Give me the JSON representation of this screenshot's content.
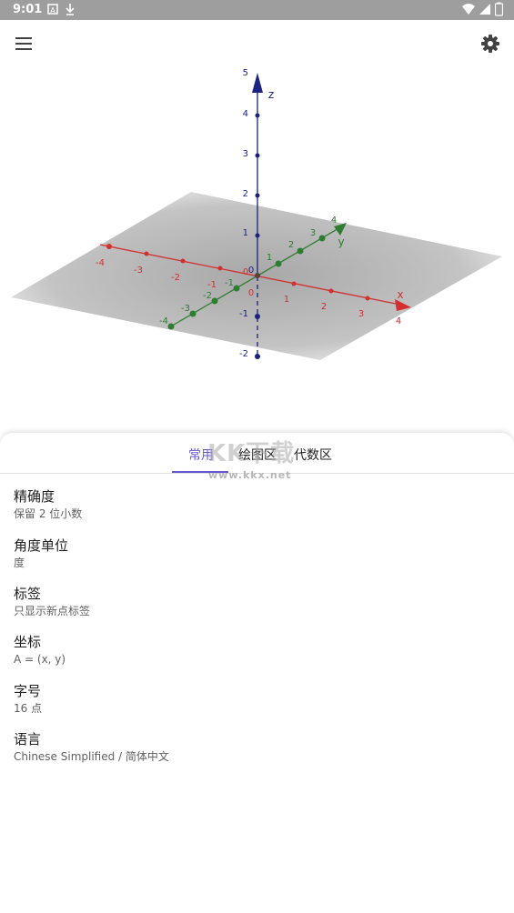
{
  "status_bar": {
    "time": "9:01",
    "left_icons": [
      "text-a-icon",
      "download-icon"
    ],
    "right_icons": [
      "wifi-icon",
      "signal-icon",
      "battery-icon"
    ]
  },
  "toolbar": {
    "menu_icon": "menu-icon",
    "settings_icon": "gear-icon"
  },
  "graph3d": {
    "axes": {
      "x": {
        "label": "x",
        "color": "#d32f2f",
        "ticks": [
          "-4",
          "-3",
          "-2",
          "-1",
          "1",
          "2",
          "3",
          "4"
        ]
      },
      "y": {
        "label": "y",
        "color": "#2e7d32",
        "ticks": [
          "-4",
          "-3",
          "-2",
          "-1",
          "1",
          "2",
          "3",
          "4"
        ]
      },
      "z": {
        "label": "z",
        "color": "#1a237e",
        "ticks": [
          "-2",
          "-1",
          "1",
          "2",
          "3",
          "4",
          "5"
        ]
      }
    },
    "origin_labels": [
      "0",
      "0",
      "0"
    ]
  },
  "watermark": {
    "brand": "KK下载",
    "url": "www.kkx.net"
  },
  "tabs": [
    {
      "label": "常用",
      "active": true
    },
    {
      "label": "绘图区",
      "active": false
    },
    {
      "label": "代数区",
      "active": false
    }
  ],
  "settings": [
    {
      "title": "精确度",
      "value": "保留 2 位小数"
    },
    {
      "title": "角度单位",
      "value": "度"
    },
    {
      "title": "标签",
      "value": "只显示新点标签"
    },
    {
      "title": "坐标",
      "value": "A = (x, y)"
    },
    {
      "title": "字号",
      "value": "16 点"
    },
    {
      "title": "语言",
      "value": "Chinese Simplified / 简体中文"
    }
  ]
}
